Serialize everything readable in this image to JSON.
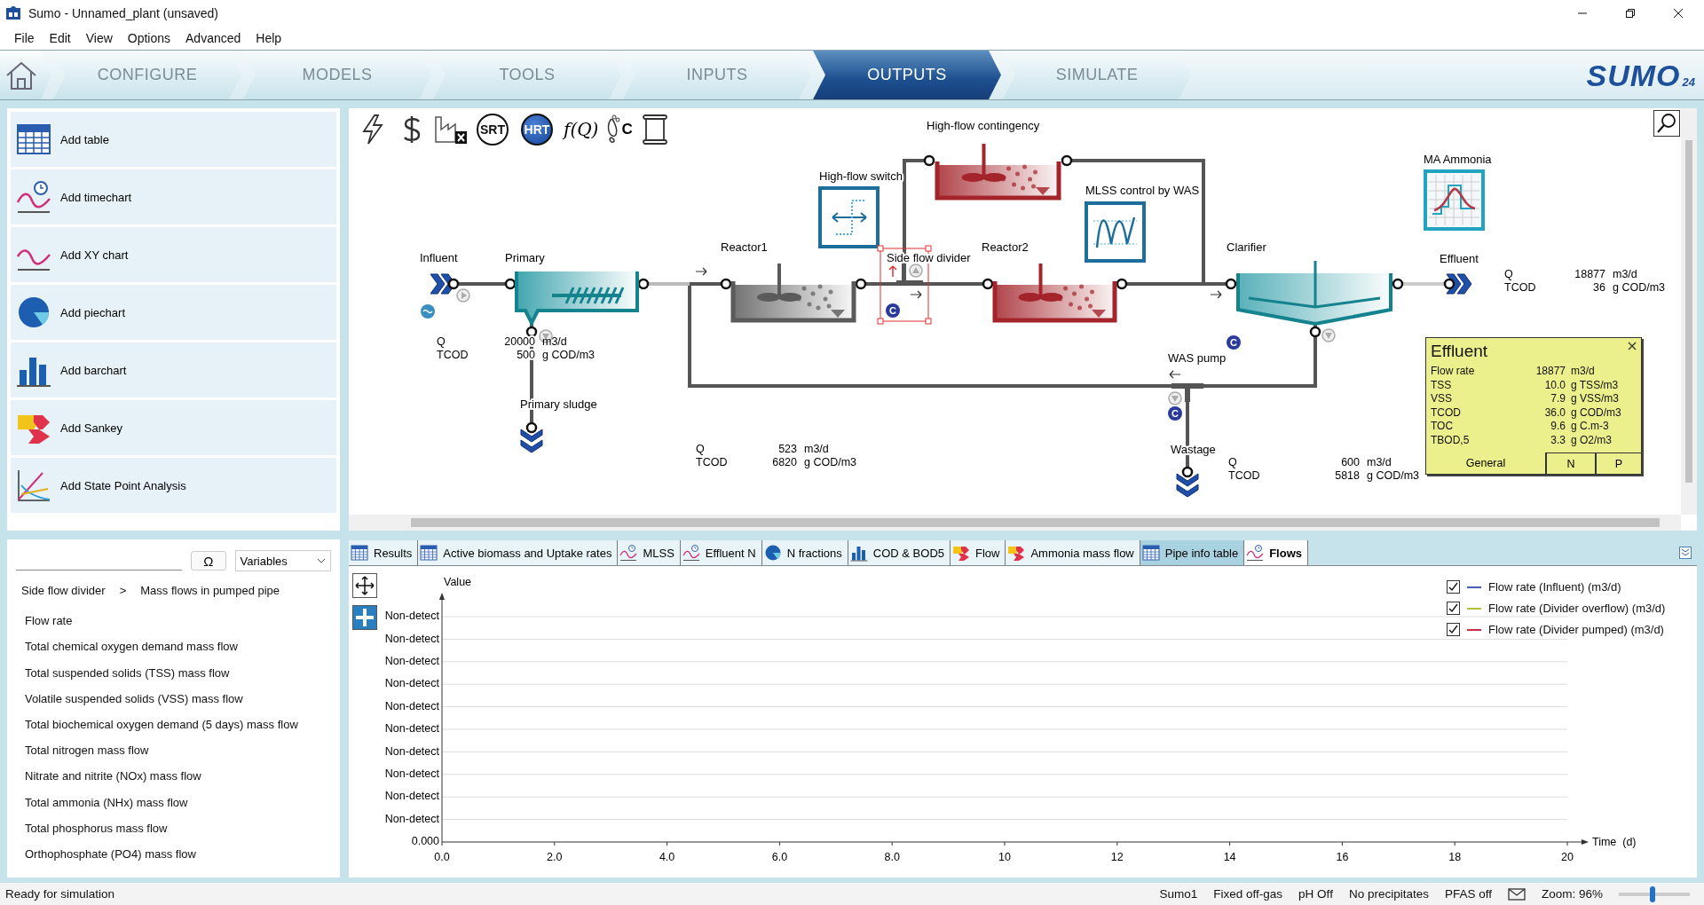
{
  "window": {
    "title": "Sumo - Unnamed_plant (unsaved)"
  },
  "menu": [
    "File",
    "Edit",
    "View",
    "Options",
    "Advanced",
    "Help"
  ],
  "nav": {
    "tabs": [
      {
        "label": "CONFIGURE",
        "selected": false
      },
      {
        "label": "MODELS",
        "selected": false
      },
      {
        "label": "TOOLS",
        "selected": false
      },
      {
        "label": "INPUTS",
        "selected": false
      },
      {
        "label": "OUTPUTS",
        "selected": true
      },
      {
        "label": "SIMULATE",
        "selected": false
      }
    ],
    "logo": {
      "text": "SUMO",
      "badge": "24"
    }
  },
  "add_buttons": [
    {
      "kind": "table",
      "label": "Add table"
    },
    {
      "kind": "timechart",
      "label": "Add timechart"
    },
    {
      "kind": "xy",
      "label": "Add XY chart"
    },
    {
      "kind": "pie",
      "label": "Add piechart"
    },
    {
      "kind": "bar",
      "label": "Add barchart"
    },
    {
      "kind": "sankey",
      "label": "Add Sankey"
    },
    {
      "kind": "spa",
      "label": "Add State Point Analysis"
    }
  ],
  "variables_panel": {
    "symbol_button": "Ω",
    "filter": {
      "value": "Variables"
    },
    "breadcrumb": [
      "Side flow divider",
      "Mass flows in pumped pipe"
    ],
    "breadcrumb_separator": ">",
    "variables": [
      "Flow rate",
      "Total chemical oxygen demand mass flow",
      "Total suspended solids (TSS) mass flow",
      "Volatile suspended solids (VSS) mass flow",
      "Total biochemical oxygen demand (5 days) mass flow",
      "Total nitrogen mass flow",
      "Nitrate and nitrite (NOx) mass flow",
      "Total ammonia (NHx) mass flow",
      "Total phosphorus mass flow",
      "Orthophosphate (PO4) mass flow"
    ]
  },
  "diagram": {
    "toolbar": [
      {
        "kind": "energy"
      },
      {
        "kind": "cost"
      },
      {
        "kind": "emissions"
      },
      {
        "kind": "circle",
        "label": "SRT",
        "selected": false
      },
      {
        "kind": "circle",
        "label": "HRT",
        "selected": true
      },
      {
        "kind": "function",
        "label": "f(Q)"
      },
      {
        "kind": "footprint",
        "label": "C"
      },
      {
        "kind": "report"
      }
    ],
    "units": [
      {
        "kind": "reactor",
        "label": "High-flow contingency",
        "color": "#a3242b",
        "selected": false
      },
      {
        "kind": "switch",
        "label": "High-flow switch",
        "selected": false
      },
      {
        "kind": "controller",
        "label": "MLSS control by WAS",
        "selected": false
      },
      {
        "kind": "profile",
        "label": "MA Ammonia",
        "selected": false
      },
      {
        "kind": "influent",
        "label": "Influent",
        "selected": false
      },
      {
        "kind": "primary",
        "label": "Primary",
        "selected": false
      },
      {
        "kind": "reactor",
        "label": "Reactor1",
        "color": "#5a5a5a",
        "selected": false
      },
      {
        "kind": "divider",
        "label": "Side flow divider",
        "selected": true
      },
      {
        "kind": "reactor",
        "label": "Reactor2",
        "color": "#a3242b",
        "selected": false
      },
      {
        "kind": "clarifier",
        "label": "Clarifier",
        "selected": false
      },
      {
        "kind": "effluent",
        "label": "Effluent",
        "selected": false
      },
      {
        "kind": "pump",
        "label": "WAS pump",
        "selected": false
      },
      {
        "kind": "sludge",
        "label": "Primary sludge",
        "selected": false
      },
      {
        "kind": "sludge",
        "label": "Wastage",
        "selected": false
      }
    ],
    "readings": [
      {
        "rows": [
          {
            "name": "Q",
            "value": "20000",
            "unit": "m3/d"
          },
          {
            "name": "TCOD",
            "value": "500",
            "unit": "g COD/m3"
          }
        ]
      },
      {
        "rows": [
          {
            "name": "Q",
            "value": "18877",
            "unit": "m3/d"
          },
          {
            "name": "TCOD",
            "value": "36",
            "unit": "g COD/m3"
          }
        ]
      },
      {
        "rows": [
          {
            "name": "Q",
            "value": "523",
            "unit": "m3/d"
          },
          {
            "name": "TCOD",
            "value": "6820",
            "unit": "g COD/m3"
          }
        ]
      },
      {
        "rows": [
          {
            "name": "Q",
            "value": "600",
            "unit": "m3/d"
          },
          {
            "name": "TCOD",
            "value": "5818",
            "unit": "g COD/m3"
          }
        ]
      }
    ],
    "badges": [
      {
        "label": "C"
      },
      {
        "label": "C"
      },
      {
        "label": "C"
      }
    ],
    "popup": {
      "title": "Effluent",
      "rows": [
        {
          "name": "Flow rate",
          "value": "18877",
          "unit": "m3/d"
        },
        {
          "name": "TSS",
          "value": "10.0",
          "unit": "g TSS/m3"
        },
        {
          "name": "VSS",
          "value": "7.9",
          "unit": "g VSS/m3"
        },
        {
          "name": "TCOD",
          "value": "36.0",
          "unit": "g COD/m3"
        },
        {
          "name": "TOC",
          "value": "9.6",
          "unit": "g C.m-3"
        },
        {
          "name": "TBOD,5",
          "value": "3.3",
          "unit": "g O2/m3"
        }
      ],
      "tabs": [
        {
          "label": "General",
          "selected": true
        },
        {
          "label": "N",
          "selected": false
        },
        {
          "label": "P",
          "selected": false
        }
      ]
    }
  },
  "output_tabs": [
    {
      "kind": "table",
      "label": "Results",
      "selected": false,
      "highlighted": false
    },
    {
      "kind": "table",
      "label": "Active biomass and Uptake rates",
      "selected": false,
      "highlighted": false
    },
    {
      "kind": "timechart",
      "label": "MLSS",
      "selected": false,
      "highlighted": false
    },
    {
      "kind": "timechart",
      "label": "Effluent N",
      "selected": false,
      "highlighted": false
    },
    {
      "kind": "pie",
      "label": "N fractions",
      "selected": false,
      "highlighted": false
    },
    {
      "kind": "bar",
      "label": "COD & BOD5",
      "selected": false,
      "highlighted": false
    },
    {
      "kind": "sankey",
      "label": "Flow",
      "selected": false,
      "highlighted": false
    },
    {
      "kind": "sankey",
      "label": "Ammonia mass flow",
      "selected": false,
      "highlighted": false
    },
    {
      "kind": "table",
      "label": "Pipe info table",
      "selected": false,
      "highlighted": true
    },
    {
      "kind": "timechart",
      "label": "Flows",
      "selected": true,
      "highlighted": false
    }
  ],
  "chart": {
    "y_axis_labels": [
      "Non-detect",
      "Non-detect",
      "Non-detect",
      "Non-detect",
      "Non-detect",
      "Non-detect",
      "Non-detect",
      "Non-detect",
      "Non-detect",
      "Non-detect",
      "0.000"
    ],
    "y_title": "Value",
    "x_title": "Time  (d)",
    "x_axis_labels": [
      "0.0",
      "2.0",
      "4.0",
      "6.0",
      "8.0",
      "10",
      "12",
      "14",
      "16",
      "18",
      "20"
    ],
    "legend": [
      {
        "name": "Flow rate (Influent) (m3/d)",
        "color": "#4a5fb0",
        "checked": true
      },
      {
        "name": "Flow rate (Divider overflow) (m3/d)",
        "color": "#b5bd3a",
        "checked": true
      },
      {
        "name": "Flow rate (Divider pumped) (m3/d)",
        "color": "#c8304a",
        "checked": true
      }
    ]
  },
  "status_bar": {
    "message": "Ready for simulation",
    "items": [
      "Sumo1",
      "Fixed off-gas",
      "pH Off",
      "No precipitates",
      "PFAS off"
    ],
    "zoom": "Zoom: 96%",
    "zoom_slider": {
      "level": 0.47
    }
  }
}
